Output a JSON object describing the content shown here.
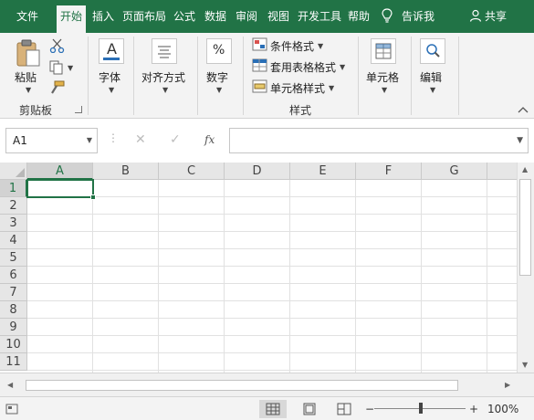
{
  "tabs": [
    {
      "label": "文件",
      "active": false
    },
    {
      "label": "开始",
      "active": true
    },
    {
      "label": "插入",
      "active": false
    },
    {
      "label": "页面布局",
      "active": false
    },
    {
      "label": "公式",
      "active": false
    },
    {
      "label": "数据",
      "active": false
    },
    {
      "label": "审阅",
      "active": false
    },
    {
      "label": "视图",
      "active": false
    },
    {
      "label": "开发工具",
      "active": false
    },
    {
      "label": "帮助",
      "active": false
    }
  ],
  "tell_me": "告诉我",
  "share": "共享",
  "ribbon": {
    "paste": "粘贴",
    "clipboard_group": "剪贴板",
    "font": "字体",
    "alignment": "对齐方式",
    "number": "数字",
    "conditional_formatting": "条件格式",
    "format_as_table": "套用表格格式",
    "cell_styles": "单元格样式",
    "styles_group": "样式",
    "cells": "单元格",
    "editing": "编辑",
    "font_icon_glyph": "A",
    "number_icon_glyph": "%"
  },
  "formula_bar": {
    "name_box": "A1",
    "formula": "",
    "cancel_glyph": "✕",
    "enter_glyph": "✓",
    "fx_glyph": "fx"
  },
  "grid": {
    "columns": [
      "A",
      "B",
      "C",
      "D",
      "E",
      "F",
      "G"
    ],
    "rows": [
      "1",
      "2",
      "3",
      "4",
      "5",
      "6",
      "7",
      "8",
      "9",
      "10",
      "11"
    ],
    "active_cell": "A1"
  },
  "status": {
    "zoom": "100%",
    "zoom_level": 1.0,
    "zoom_minus": "−",
    "zoom_plus": "+"
  },
  "colors": {
    "accent": "#217346",
    "ribbon_bg": "#f3f3f3"
  }
}
